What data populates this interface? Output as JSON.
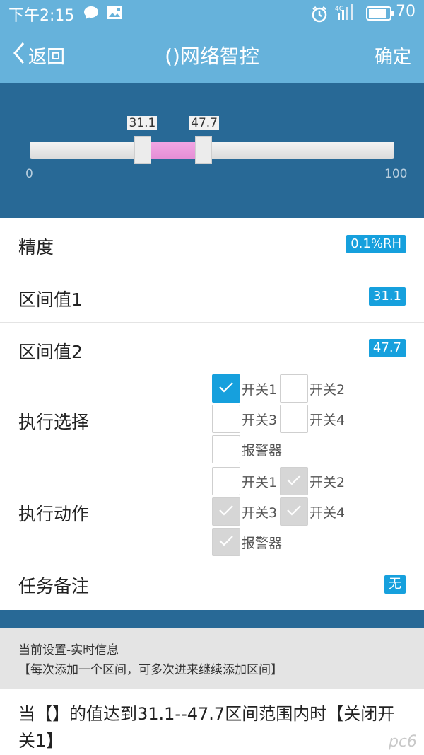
{
  "status_bar": {
    "time": "下午2:15",
    "network": "4G",
    "battery": "70"
  },
  "header": {
    "back_label": "返回",
    "title": "()网络智控",
    "confirm_label": "确定"
  },
  "range_slider": {
    "min": 0,
    "max": 100,
    "low": 31.1,
    "high": 47.7,
    "low_label": "31.1",
    "high_label": "47.7",
    "min_label": "0",
    "max_label": "100"
  },
  "precision": {
    "label": "精度",
    "value": "0.1%RH"
  },
  "interval1": {
    "label": "区间值1",
    "value": "31.1"
  },
  "interval2": {
    "label": "区间值2",
    "value": "47.7"
  },
  "exec_select": {
    "label": "执行选择",
    "options": [
      {
        "label": "开关1",
        "state": "checked"
      },
      {
        "label": "开关2",
        "state": "unchecked"
      },
      {
        "label": "开关3",
        "state": "unchecked"
      },
      {
        "label": "开关4",
        "state": "unchecked"
      },
      {
        "label": "报警器",
        "state": "unchecked"
      }
    ]
  },
  "exec_action": {
    "label": "执行动作",
    "options": [
      {
        "label": "开关1",
        "state": "unchecked"
      },
      {
        "label": "开关2",
        "state": "disabled"
      },
      {
        "label": "开关3",
        "state": "disabled"
      },
      {
        "label": "开关4",
        "state": "disabled"
      },
      {
        "label": "报警器",
        "state": "disabled"
      }
    ]
  },
  "task_note": {
    "label": "任务备注",
    "value": "无"
  },
  "info": {
    "title": "当前设置-实时信息",
    "subtitle": "【每次添加一个区间，可多次进来继续添加区间】",
    "summary": "当【】的值达到31.1--47.7区间范围内时【关闭开关1】"
  },
  "watermark": "pc6",
  "colors": {
    "header": "#66b2db",
    "panel": "#286996",
    "accent": "#16a0dd",
    "range_fill": "#e58fd6"
  }
}
